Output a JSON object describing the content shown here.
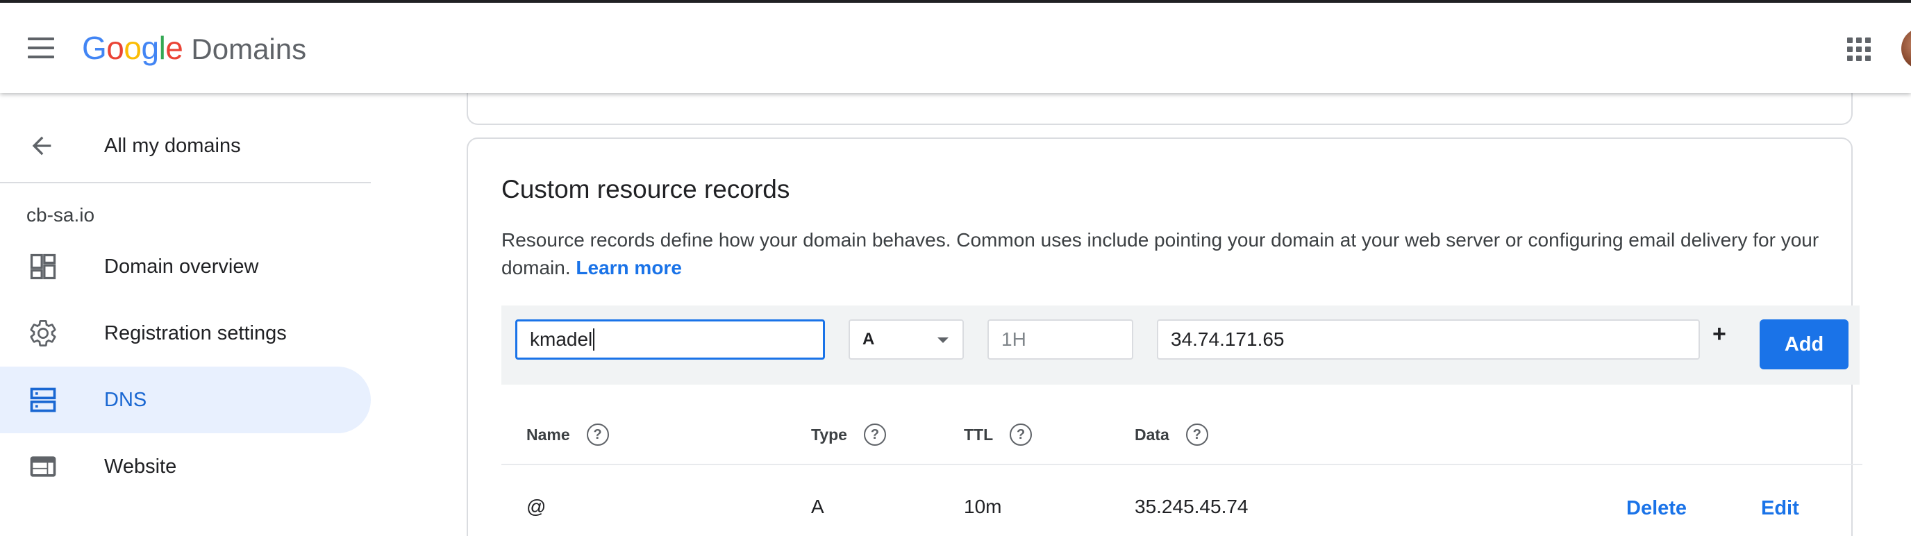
{
  "header": {
    "logo_text": "Google",
    "product": "Domains"
  },
  "sidebar": {
    "back_label": "All my domains",
    "domain": "cb-sa.io",
    "items": [
      {
        "label": "Domain overview",
        "icon": "dashboard-icon"
      },
      {
        "label": "Registration settings",
        "icon": "gear-icon"
      },
      {
        "label": "DNS",
        "icon": "dns-icon",
        "active": true
      },
      {
        "label": "Website",
        "icon": "web-icon"
      }
    ]
  },
  "card": {
    "title": "Custom resource records",
    "description": "Resource records define how your domain behaves. Common uses include pointing your domain at your web server or configuring email delivery for your domain.",
    "learn_more": "Learn more"
  },
  "form": {
    "name_value": "kmadel",
    "type_value": "A",
    "ttl_placeholder": "1H",
    "data_value": "34.74.171.65",
    "plus_label": "+",
    "add_label": "Add"
  },
  "table": {
    "columns": [
      "Name",
      "Type",
      "TTL",
      "Data"
    ],
    "rows": [
      {
        "name": "@",
        "type": "A",
        "ttl": "10m",
        "data": "35.245.45.74",
        "delete": "Delete",
        "edit": "Edit"
      }
    ]
  },
  "colors": {
    "accent": "#1a73e8",
    "active_bg": "#e8f0fe"
  }
}
